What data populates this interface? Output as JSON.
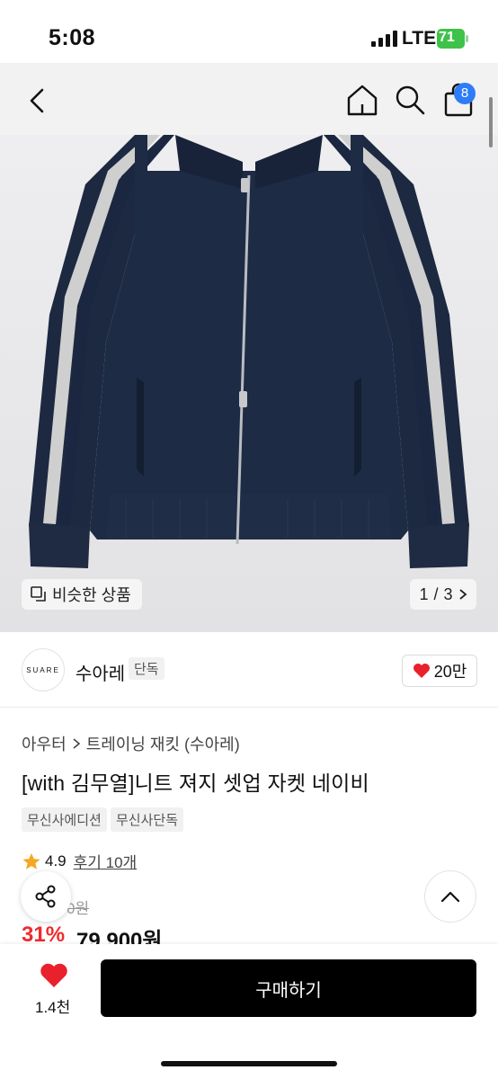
{
  "status": {
    "time": "5:08",
    "network": "LTE",
    "battery": "71"
  },
  "nav": {
    "cart_count": "8",
    "icons": [
      "back-icon",
      "home-icon",
      "search-icon",
      "bag-icon"
    ]
  },
  "image": {
    "similar_label": "비슷한 상품",
    "page_current": "1",
    "page_sep": "/",
    "page_total": "3"
  },
  "brand": {
    "logo_text": "SUARE",
    "name": "수아레",
    "tag": "단독",
    "likes": "20만"
  },
  "product": {
    "breadcrumb": [
      "아우터",
      "트레이닝 재킷 (수아레)"
    ],
    "title": "[with 김무열]니트 져지 셋업 자켓 네이비",
    "tags": [
      "무신사에디션",
      "무신사단독"
    ],
    "rating": "4.9",
    "reviews": "후기 10개",
    "original_price": "0원",
    "discount": "31%",
    "price": "79,900원"
  },
  "bottom": {
    "wish_count": "1.4천",
    "buy_label": "구매하기"
  },
  "colors": {
    "accent_blue": "#2e7cf6",
    "discount_red": "#ef2b2b",
    "heart_red": "#e8212c",
    "jacket_navy": "#1c2940"
  }
}
